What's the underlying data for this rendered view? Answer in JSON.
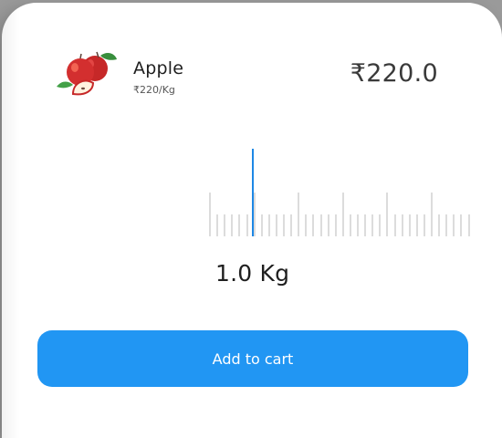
{
  "product": {
    "name": "Apple",
    "unit_price": "₹220/Kg",
    "total_price": "₹220.0",
    "image_icon": "apple-image"
  },
  "scale": {
    "selected_weight": "1.0 Kg",
    "selected_value": 1.0,
    "indicator_color": "#1e88e5",
    "tick_color": "#dcdcdc"
  },
  "actions": {
    "add_to_cart_label": "Add to cart",
    "button_color": "#2196f3"
  }
}
